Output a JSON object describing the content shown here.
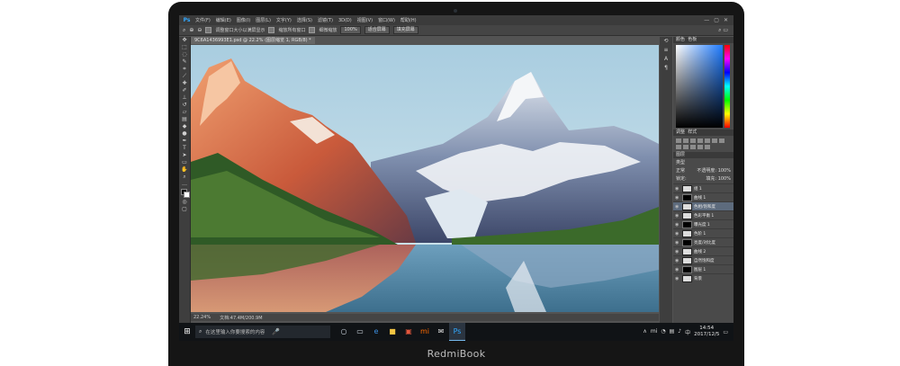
{
  "device": {
    "brand": "RedmiBook"
  },
  "photoshop": {
    "logo": "Ps",
    "menus": [
      "文件(F)",
      "编辑(E)",
      "图像(I)",
      "图层(L)",
      "文字(Y)",
      "选择(S)",
      "滤镜(T)",
      "3D(D)",
      "视图(V)",
      "窗口(W)",
      "帮助(H)"
    ],
    "window_controls": [
      "—",
      "▢",
      "✕"
    ],
    "options": {
      "resize_windows": "调整窗口大小以满屏显示",
      "zoom_all": "缩放所有窗口",
      "scrubby_zoom": "细微缩放",
      "btn_100": "100%",
      "btn_fit": "适合屏幕",
      "btn_fill": "填充屏幕"
    },
    "document_tab": "9C6A1436993E1.psd @ 22.2% (图层缩览 1, RGB/8) *",
    "status": {
      "zoom": "22.24%",
      "doc": "文档:47.4M/200.9M"
    },
    "panels": {
      "color_tab": "颜色",
      "swatches_tab": "色板",
      "adjust_tab": "调整",
      "adjust_subtab": "样式",
      "layers_tab": "图层",
      "layers_kind": "类型",
      "blend_mode": "正常",
      "opacity": "不透明度: 100%",
      "lock": "锁定:",
      "fill": "填充: 100%",
      "layers": [
        {
          "name": "组 1",
          "selected": false
        },
        {
          "name": "曲线 1",
          "selected": false
        },
        {
          "name": "色相/饱和度",
          "selected": true
        },
        {
          "name": "色彩平衡 1",
          "selected": false
        },
        {
          "name": "曝光度 1",
          "selected": false
        },
        {
          "name": "色阶 1",
          "selected": false
        },
        {
          "name": "亮度/对比度",
          "selected": false
        },
        {
          "name": "曲线 2",
          "selected": false
        },
        {
          "name": "自然饱和度",
          "selected": false
        },
        {
          "name": "图层 1",
          "selected": false
        },
        {
          "name": "背景",
          "selected": false
        }
      ]
    }
  },
  "taskbar": {
    "search_placeholder": "在这里输入你要搜索的内容",
    "apps": [
      {
        "name": "cortana",
        "glyph": "○",
        "color": "#cfd8e3"
      },
      {
        "name": "task-view",
        "glyph": "▭",
        "color": "#cfd8e3"
      },
      {
        "name": "edge",
        "glyph": "e",
        "color": "#3c8fe0"
      },
      {
        "name": "file-explorer",
        "glyph": "■",
        "color": "#f4c542"
      },
      {
        "name": "store",
        "glyph": "▣",
        "color": "#e4573d"
      },
      {
        "name": "mi",
        "glyph": "mi",
        "color": "#ff6a00"
      },
      {
        "name": "mail",
        "glyph": "✉",
        "color": "#e6e6e6"
      },
      {
        "name": "photoshop",
        "glyph": "Ps",
        "color": "#31a8ff"
      }
    ],
    "tray_glyphs": [
      "∧",
      "mi",
      "◔",
      "▤",
      "♪",
      "中"
    ],
    "time": "14:54",
    "date": "2017/12/5"
  }
}
